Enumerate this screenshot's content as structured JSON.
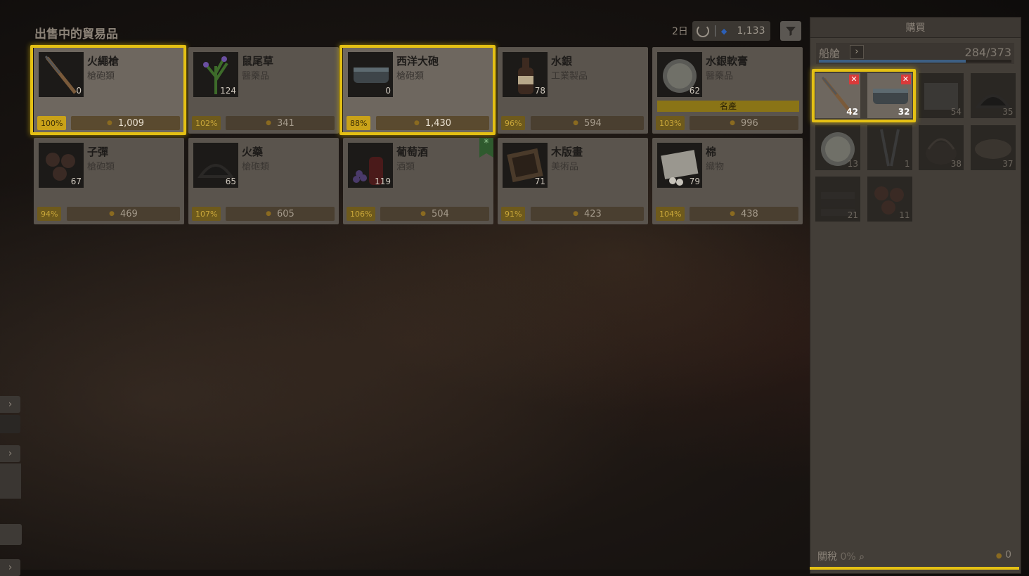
{
  "header": {
    "title": "出售中的貿易品",
    "days": "2日",
    "gem_count": "1,133"
  },
  "goods": [
    {
      "name": "火繩槍",
      "category": "槍砲類",
      "qty": "0",
      "pct": "100%",
      "price": "1,009",
      "selected": true,
      "art": "musket"
    },
    {
      "name": "鼠尾草",
      "category": "醫藥品",
      "qty": "124",
      "pct": "102%",
      "price": "341",
      "selected": false,
      "art": "herb"
    },
    {
      "name": "西洋大砲",
      "category": "槍砲類",
      "qty": "0",
      "pct": "88%",
      "price": "1,430",
      "selected": true,
      "art": "cannon"
    },
    {
      "name": "水銀",
      "category": "工業製品",
      "qty": "78",
      "pct": "96%",
      "price": "594",
      "selected": false,
      "art": "bottle"
    },
    {
      "name": "水銀軟膏",
      "category": "醫藥品",
      "qty": "62",
      "pct": "103%",
      "price": "996",
      "selected": false,
      "banner": "名產",
      "art": "ointment"
    },
    {
      "name": "子彈",
      "category": "槍砲類",
      "qty": "67",
      "pct": "94%",
      "price": "469",
      "selected": false,
      "art": "balls"
    },
    {
      "name": "火藥",
      "category": "槍砲類",
      "qty": "65",
      "pct": "107%",
      "price": "605",
      "selected": false,
      "art": "powder"
    },
    {
      "name": "葡萄酒",
      "category": "酒類",
      "qty": "119",
      "pct": "106%",
      "price": "504",
      "selected": false,
      "flag": true,
      "art": "wine"
    },
    {
      "name": "木版畫",
      "category": "美術品",
      "qty": "71",
      "pct": "91%",
      "price": "423",
      "selected": false,
      "art": "print"
    },
    {
      "name": "棉",
      "category": "織物",
      "qty": "79",
      "pct": "104%",
      "price": "438",
      "selected": false,
      "art": "cotton"
    }
  ],
  "purchase": {
    "title": "購買",
    "hold_label": "船艙",
    "hold_value": "284/373",
    "hold_fill": 0.761,
    "slots": [
      {
        "qty": "42",
        "active": true,
        "art": "musket"
      },
      {
        "qty": "32",
        "active": true,
        "art": "cannon"
      },
      {
        "qty": "54",
        "active": false,
        "art": "cloth"
      },
      {
        "qty": "35",
        "active": false,
        "art": "powder"
      },
      {
        "qty": "13",
        "active": false,
        "art": "ointment"
      },
      {
        "qty": "1",
        "active": false,
        "art": "daggers"
      },
      {
        "qty": "38",
        "active": false,
        "art": "basket"
      },
      {
        "qty": "37",
        "active": false,
        "art": "bread"
      },
      {
        "qty": "21",
        "active": false,
        "art": "wood"
      },
      {
        "qty": "11",
        "active": false,
        "art": "balls"
      }
    ],
    "tax_label": "關稅",
    "tax_value": "0%",
    "total": "0"
  },
  "colors": {
    "highlight": "#e4c014",
    "accent_pct": "#c9a219",
    "gem": "#2c5fb5",
    "remove": "#d93a3a"
  }
}
